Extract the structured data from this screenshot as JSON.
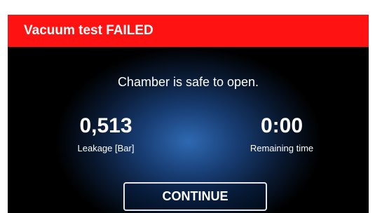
{
  "header": {
    "title": "Vacuum test FAILED",
    "color": "#ff1212"
  },
  "message": "Chamber is safe to open.",
  "readouts": {
    "leakage": {
      "value": "0,513",
      "label": "Leakage [Bar]"
    },
    "remaining_time": {
      "value": "0:00",
      "label": "Remaining time"
    }
  },
  "continue_button": {
    "label": "CONTINUE"
  }
}
